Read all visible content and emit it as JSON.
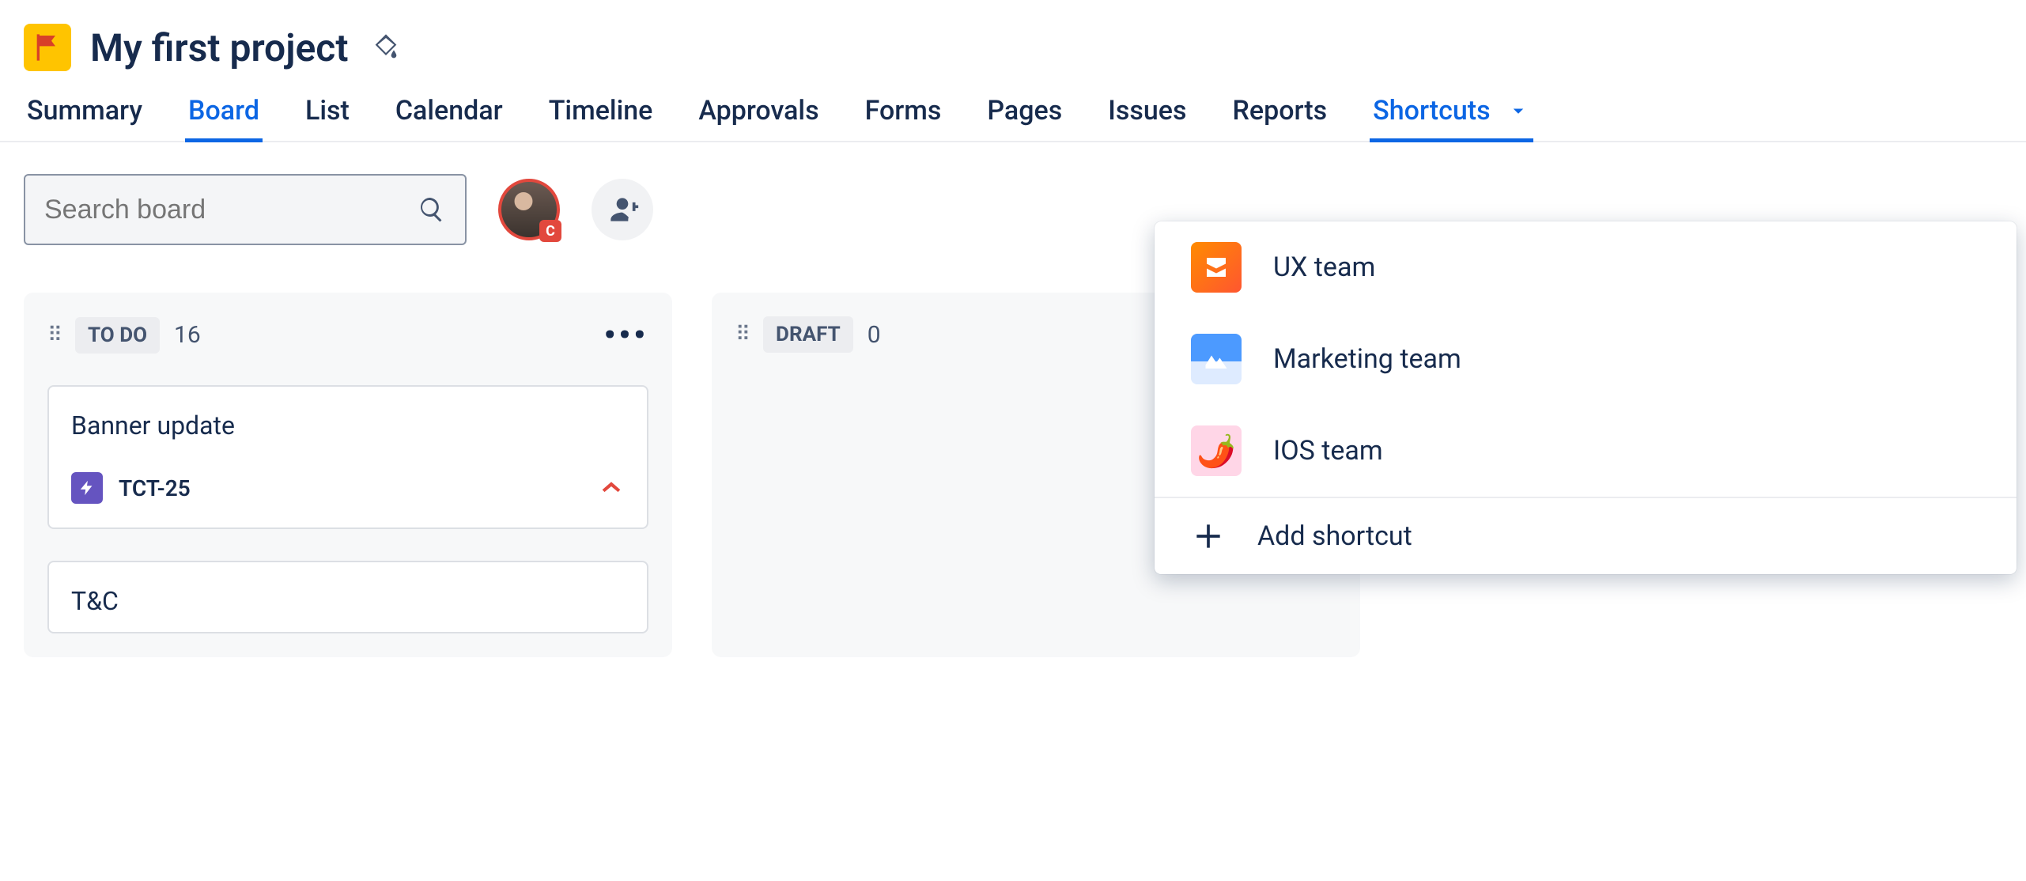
{
  "project": {
    "title": "My first project"
  },
  "tabs": [
    {
      "label": "Summary",
      "active": false
    },
    {
      "label": "Board",
      "active": true
    },
    {
      "label": "List",
      "active": false
    },
    {
      "label": "Calendar",
      "active": false
    },
    {
      "label": "Timeline",
      "active": false
    },
    {
      "label": "Approvals",
      "active": false
    },
    {
      "label": "Forms",
      "active": false
    },
    {
      "label": "Pages",
      "active": false
    },
    {
      "label": "Issues",
      "active": false
    },
    {
      "label": "Reports",
      "active": false
    },
    {
      "label": "Shortcuts",
      "active": false,
      "dropdown_open": true
    }
  ],
  "search": {
    "placeholder": "Search board"
  },
  "avatar": {
    "badge": "C"
  },
  "columns": [
    {
      "name": "TO DO",
      "count": "16",
      "show_more": true,
      "cards": [
        {
          "title": "Banner update",
          "key": "TCT-25",
          "show_footer": true
        },
        {
          "title": "T&C",
          "show_footer": false
        }
      ]
    },
    {
      "name": "DRAFT",
      "count": "0",
      "show_more": false,
      "cards": []
    }
  ],
  "shortcuts_menu": {
    "items": [
      {
        "label": "UX team",
        "icon": "ux"
      },
      {
        "label": "Marketing team",
        "icon": "mk"
      },
      {
        "label": "IOS team",
        "icon": "ios"
      }
    ],
    "add_label": "Add shortcut"
  }
}
